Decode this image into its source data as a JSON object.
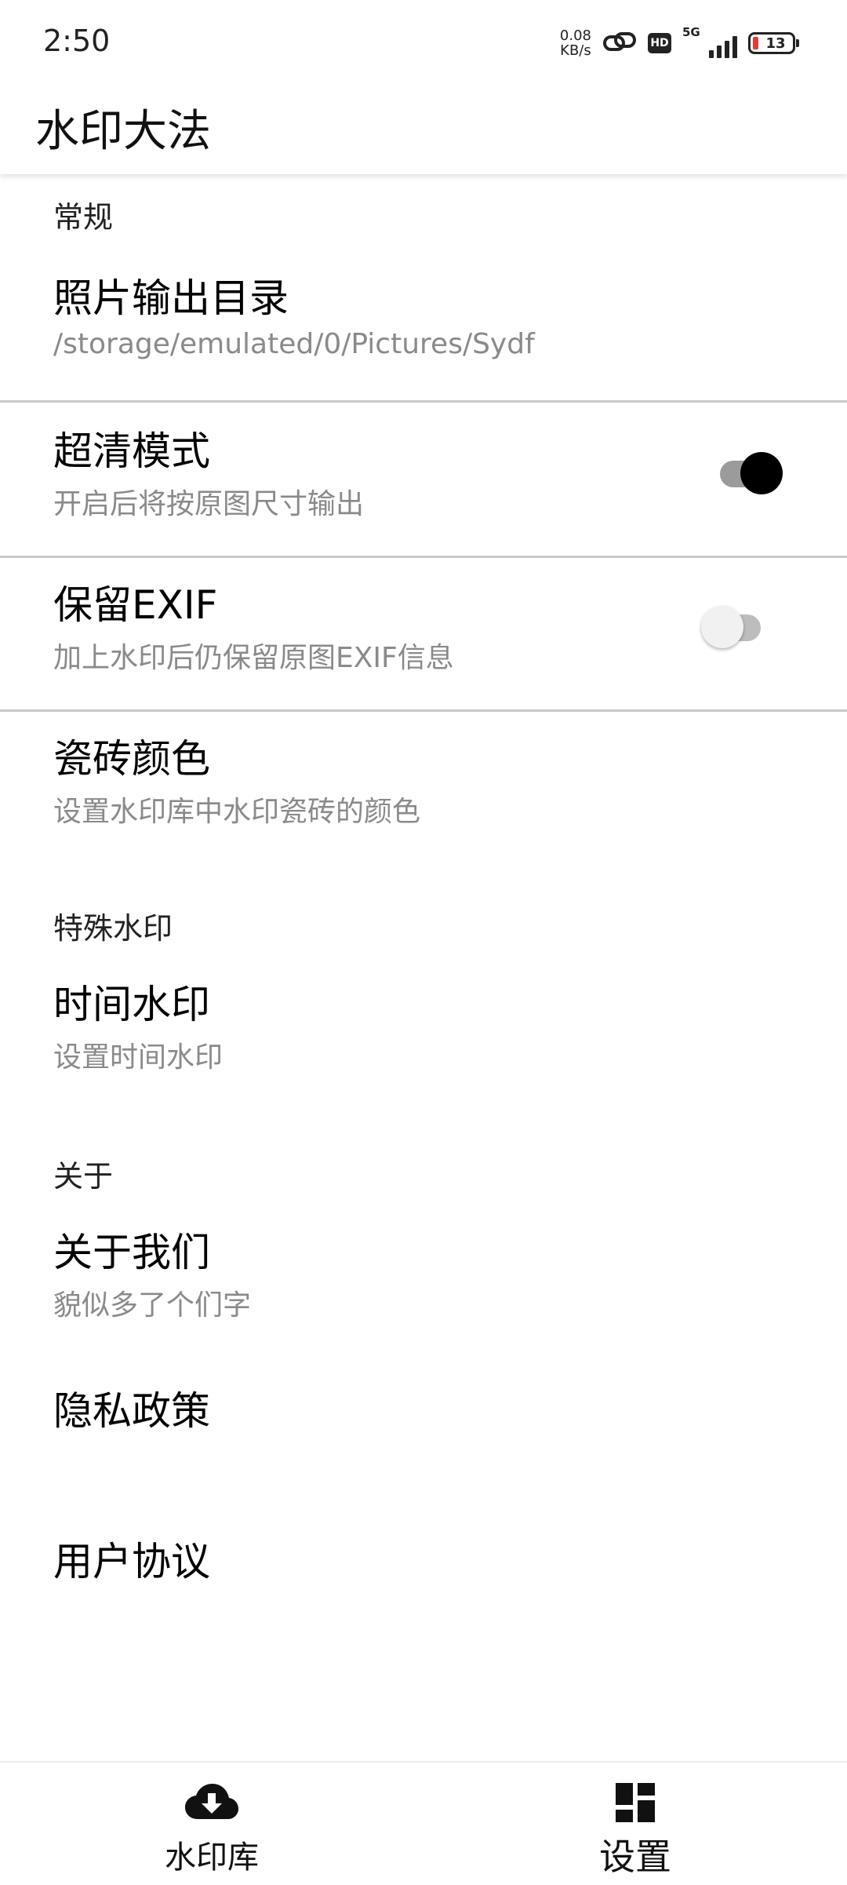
{
  "status_bar": {
    "time": "2:50",
    "net_speed_value": "0.08",
    "net_speed_unit": "KB/s",
    "hd_badge": "HD",
    "signal_label": "5G",
    "battery_level": "13"
  },
  "app_bar": {
    "title": "水印大法"
  },
  "settings": {
    "general_header": "常规",
    "output_dir": {
      "title": "照片输出目录",
      "summary": "/storage/emulated/0/Pictures/Sydf"
    },
    "hd_mode": {
      "title": "超清模式",
      "summary": "开启后将按原图尺寸输出",
      "enabled": true
    },
    "keep_exif": {
      "title": "保留EXIF",
      "summary": "加上水印后仍保留原图EXIF信息",
      "enabled": false
    },
    "tile_color": {
      "title": "瓷砖颜色",
      "summary": "设置水印库中水印瓷砖的颜色"
    },
    "special_header": "特殊水印",
    "time_watermark": {
      "title": "时间水印",
      "summary": "设置时间水印"
    },
    "about_header": "关于",
    "about_us": {
      "title": "关于我们",
      "summary": "貌似多了个们字"
    },
    "privacy_policy": {
      "title": "隐私政策"
    },
    "user_agreement": {
      "title": "用户协议"
    }
  },
  "bottom_nav": {
    "items": [
      {
        "label": "水印库",
        "icon": "cloud-download-icon",
        "active": false
      },
      {
        "label": "设置",
        "icon": "dashboard-icon",
        "active": true
      }
    ]
  }
}
